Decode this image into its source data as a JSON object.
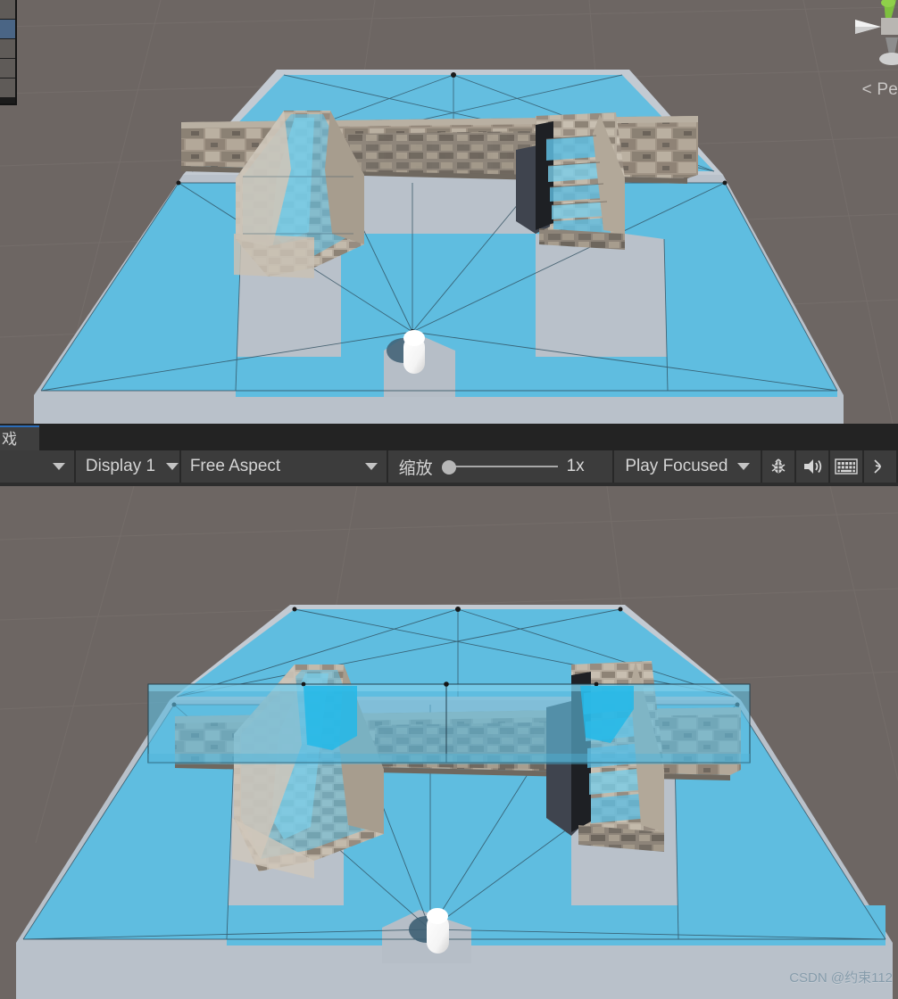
{
  "window": {
    "app": "Unity Editor",
    "background_color": "#6d6662"
  },
  "left_panel": {
    "name": "hierarchy-panel-clipped",
    "rows": [
      {
        "selected": false
      },
      {
        "selected": true
      },
      {
        "selected": false
      },
      {
        "selected": false
      },
      {
        "selected": false
      }
    ]
  },
  "scene_gizmo": {
    "label": "< Pe",
    "full_label_hint": "Persp",
    "axis_colors": {
      "x": "#d84b4b",
      "y": "#7ec03f",
      "z": "#3d7fd6"
    }
  },
  "game_toolbar": {
    "tab": {
      "label": "戏",
      "accent_color": "#2b6cb8",
      "active": true
    },
    "render_mode": {
      "label": "",
      "caret": "chevron-down-icon"
    },
    "display": {
      "label": "Display 1",
      "caret": "chevron-down-icon"
    },
    "aspect": {
      "label": "Free Aspect",
      "caret": "chevron-down-icon"
    },
    "scale": {
      "label": "缩放",
      "value": "1x",
      "slider_position_pct": 0
    },
    "play_mode": {
      "label": "Play Focused",
      "caret": "chevron-down-icon"
    },
    "icons": [
      {
        "name": "bug-icon",
        "glyph": "bug",
        "tooltip": "Debug"
      },
      {
        "name": "speaker-icon",
        "glyph": "speaker",
        "tooltip": "Mute Audio"
      },
      {
        "name": "stats-keyboard-icon",
        "glyph": "keyboard",
        "tooltip": "Stats"
      },
      {
        "name": "gizmos-icon",
        "glyph": "gizmos-partial",
        "tooltip": "Gizmos"
      }
    ]
  },
  "scenes": [
    {
      "name": "scene-view-top",
      "title_hint": "NavMesh baked - walkable surfaces",
      "navmesh_color": "#5fbde0",
      "floor_color": "#b9c1ca",
      "ramp_visible": true,
      "stairs_visible": true,
      "player_capsule_color": "#ffffff",
      "navmesh_overlay_above_geometry": false
    },
    {
      "name": "scene-view-bottom",
      "title_hint": "NavMesh baked - overlapping volume above walls",
      "navmesh_color": "#5fbde0",
      "floor_color": "#b9c1ca",
      "ramp_visible": true,
      "stairs_visible": true,
      "player_capsule_color": "#ffffff",
      "navmesh_overlay_above_geometry": true
    }
  ],
  "watermark": {
    "text": "CSDN @约束112"
  }
}
